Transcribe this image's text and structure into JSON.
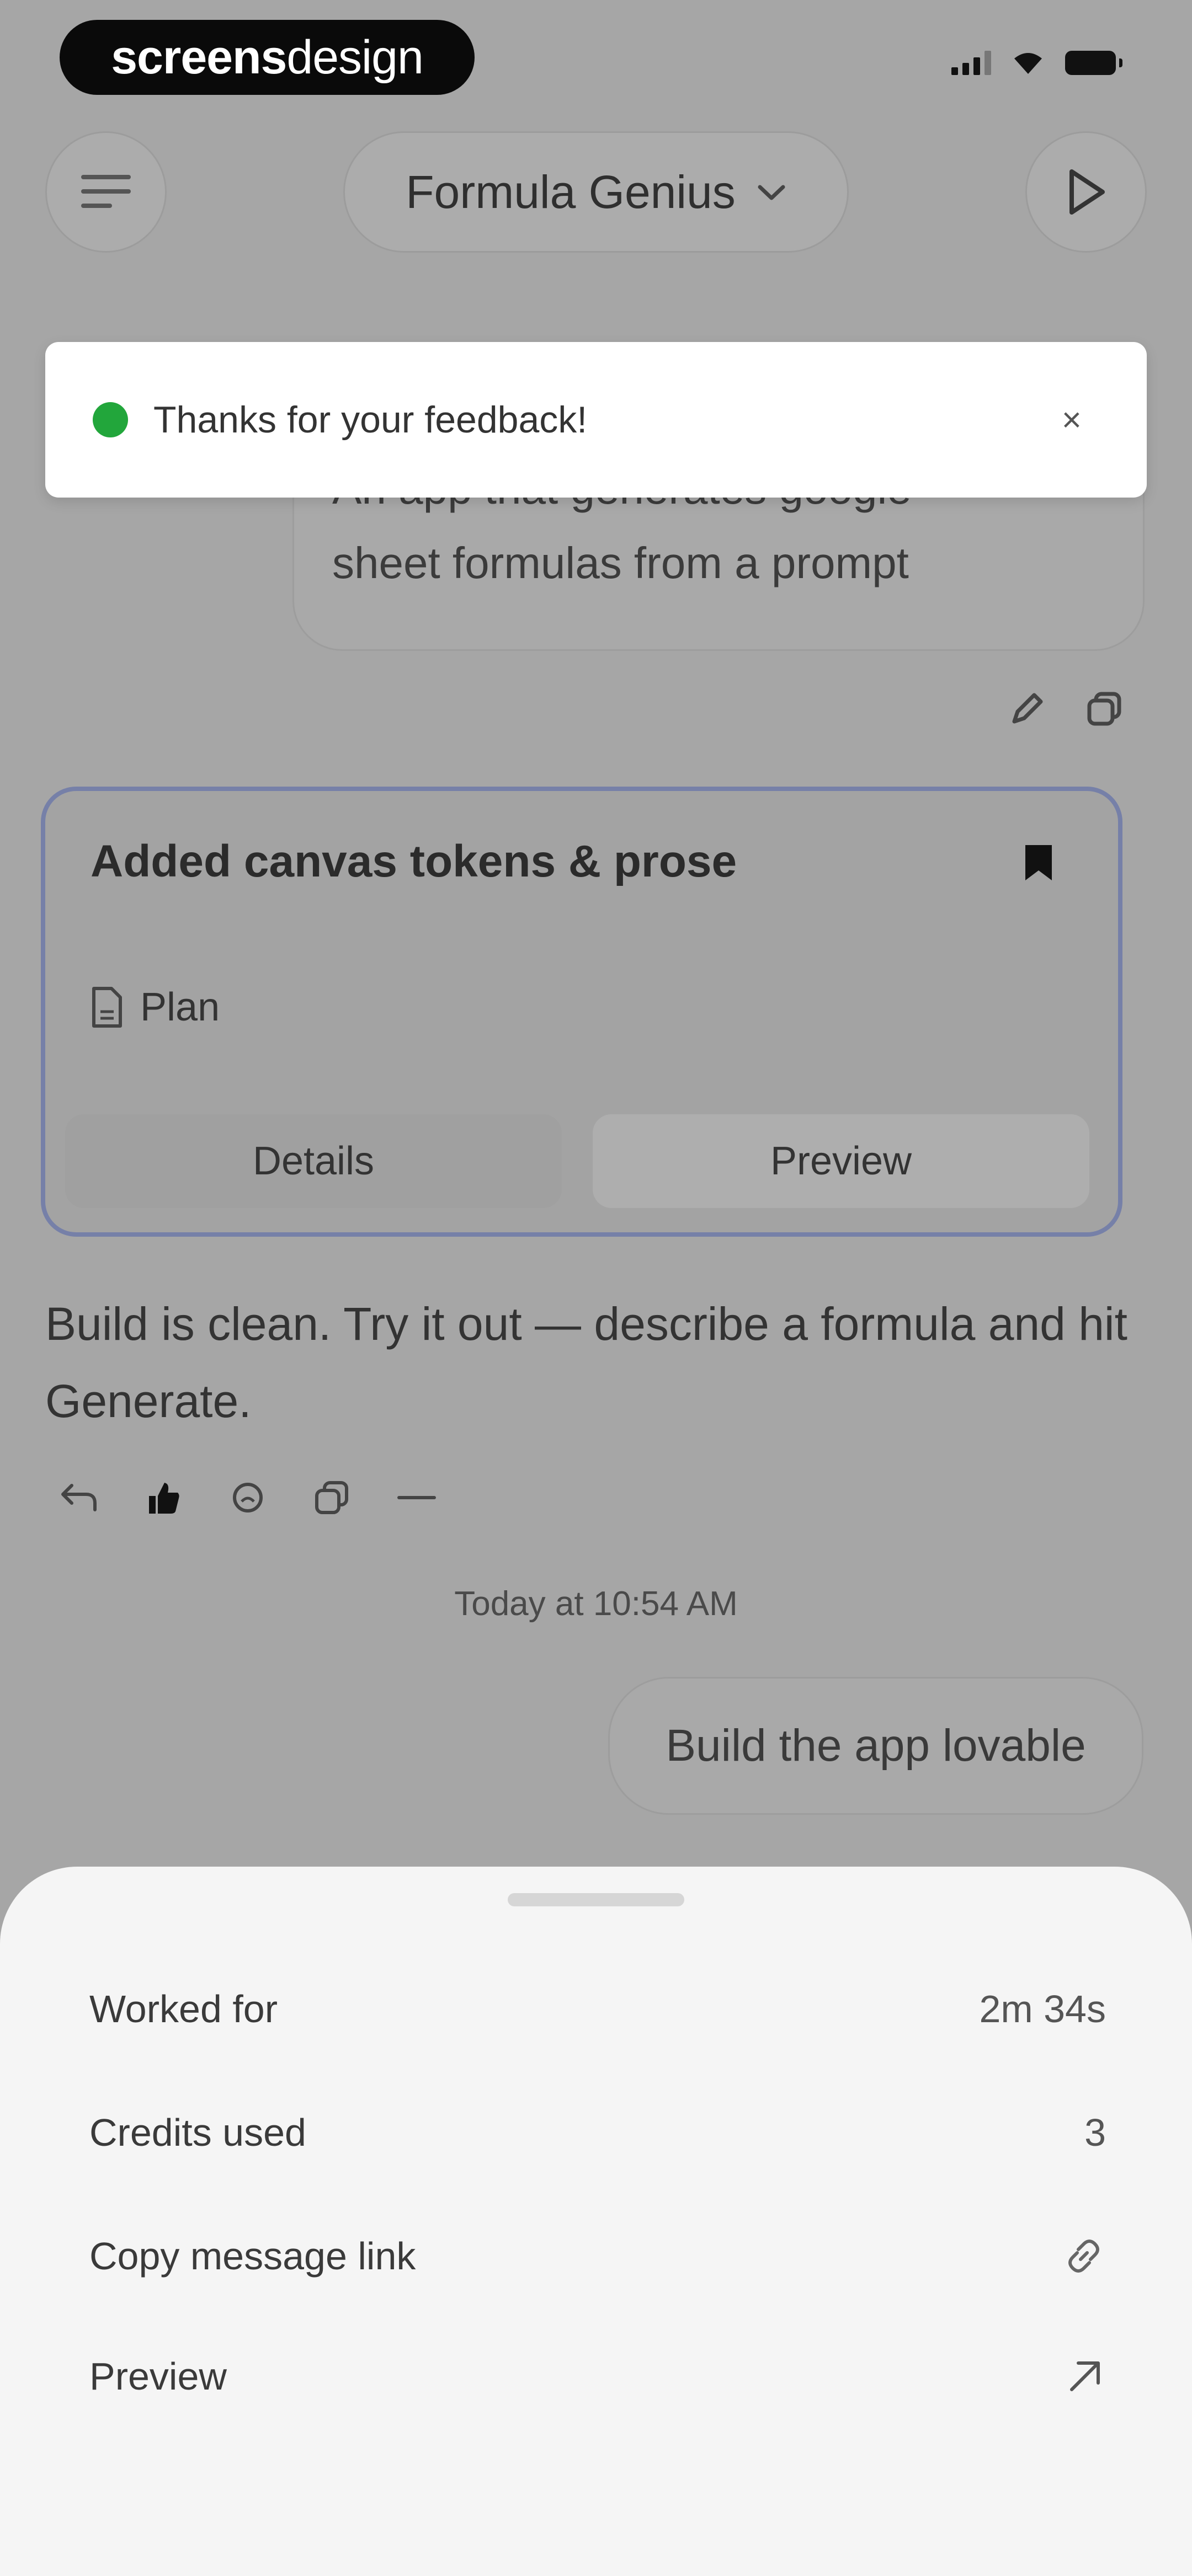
{
  "status_bar": {
    "watermark_bold": "screens",
    "watermark_light": "design"
  },
  "header": {
    "title": "Formula Genius"
  },
  "toast": {
    "message": "Thanks for your feedback!",
    "close": "×",
    "status_color": "#22a63b"
  },
  "conversation": {
    "user_message_line1": "An app that generates google",
    "user_message_line2": "sheet formulas from a prompt",
    "card": {
      "title": "Added canvas tokens & prose",
      "plan_label": "Plan",
      "details_label": "Details",
      "preview_label": "Preview",
      "border_color": "#7680a8"
    },
    "assistant_message": "Build is clean. Try it out — describe a formula and hit Generate.",
    "timestamp": "Today at 10:54 AM",
    "user_message_2": "Build the app lovable"
  },
  "sheet": {
    "rows": [
      {
        "label": "Worked for",
        "value": "2m 34s"
      },
      {
        "label": "Credits used",
        "value": "3"
      },
      {
        "label": "Copy message link",
        "icon": "link-icon"
      },
      {
        "label": "Preview",
        "icon": "arrow-up-right-icon"
      }
    ]
  }
}
